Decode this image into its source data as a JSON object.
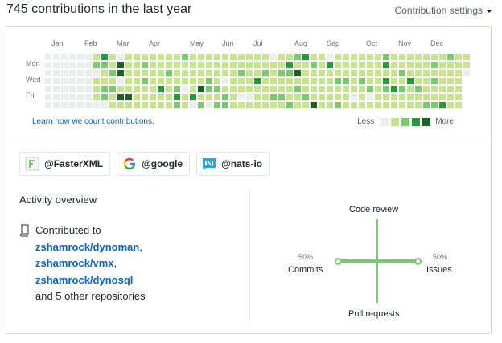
{
  "header": {
    "title": "745 contributions in the last year",
    "settings_label": "Contribution settings"
  },
  "calendar": {
    "months": [
      "Jan",
      "Feb",
      "Mar",
      "Apr",
      "May",
      "Jun",
      "Jul",
      "Aug",
      "Sep",
      "Oct",
      "Nov",
      "Dec"
    ],
    "day_labels": [
      "Mon",
      "Wed",
      "Fri"
    ],
    "learn_link": "Learn how we count contributions.",
    "legend_less": "Less",
    "legend_more": "More",
    "colors": [
      "#ebedf0",
      "#c6e48b",
      "#7bc96f",
      "#239a3b",
      "#196127"
    ]
  },
  "organizations": [
    {
      "name": "@FasterXML",
      "icon": "fasterxml-logo-icon"
    },
    {
      "name": "@google",
      "icon": "google-logo-icon"
    },
    {
      "name": "@nats-io",
      "icon": "nats-logo-icon"
    }
  ],
  "activity": {
    "title": "Activity overview",
    "contributed_to": "Contributed to",
    "repos": [
      "zshamrock/dynoman",
      "zshamrock/vmx",
      "zshamrock/dynosql"
    ],
    "others": "and 5 other repositories"
  },
  "activity_graph": {
    "code_review": "Code review",
    "issues": "Issues",
    "issues_pct": "50%",
    "pull_requests": "Pull requests",
    "commits": "Commits",
    "commits_pct": "50%"
  }
}
